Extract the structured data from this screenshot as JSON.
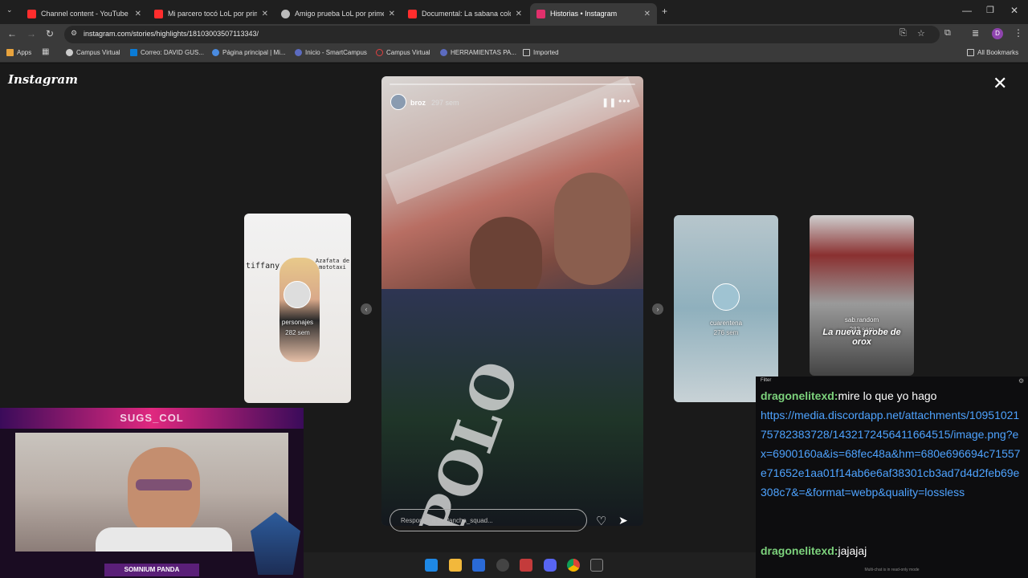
{
  "browser": {
    "tabs": [
      {
        "title": "Channel content - YouTube Stu",
        "icon": "youtube-icon",
        "color": "#ff2d2d"
      },
      {
        "title": "Mi parcero tocó LoL por prime",
        "icon": "youtube-icon",
        "color": "#ff2d2d"
      },
      {
        "title": "Amigo prueba LoL por primera",
        "icon": "globe-icon",
        "color": "#bbbbbb"
      },
      {
        "title": "Documental: La sabana colomb",
        "icon": "youtube-icon",
        "color": "#ff2d2d"
      },
      {
        "title": "Historias • Instagram",
        "icon": "instagram-icon",
        "color": "#e1306c"
      }
    ],
    "url": "instagram.com/stories/highlights/18103003507113343/",
    "bookmarks": [
      {
        "label": "Apps",
        "color": "#e8a33d"
      },
      {
        "label": "Campus Virtual",
        "color": "#cccccc"
      },
      {
        "label": "Correo: DAVID GUS...",
        "color": "#0a7bd6"
      },
      {
        "label": "Página principal | Mi...",
        "color": "#4a8be0"
      },
      {
        "label": "Inicio - SmartCampus",
        "color": "#5c6bc0"
      },
      {
        "label": "Campus Virtual",
        "color": "#e04040"
      },
      {
        "label": "HERRAMIENTAS PA...",
        "color": "#5c6bc0"
      },
      {
        "label": "Imported",
        "color": "#cccccc"
      }
    ],
    "all_bookmarks": "All Bookmarks",
    "profile_initial": "D"
  },
  "instagram": {
    "logo": "Instagram",
    "story": {
      "username": "broz",
      "time": "297 sem",
      "reply_placeholder": "Responde a avalancha_squad...",
      "shirt_text": "POLO"
    },
    "left_highlight": {
      "name": "personajes",
      "time": "282 sem",
      "overlay_left": "tiffany",
      "overlay_right": "Azafata de mototaxi"
    },
    "right_highlights": [
      {
        "name": "cuarentena",
        "time": "276 sem"
      },
      {
        "name": "sab.random",
        "time": "283 sem",
        "caption": "La nueva probe de orox"
      }
    ]
  },
  "stream": {
    "banner": "SUGS_COL",
    "footer": "SOMNIUM PANDA",
    "chat": {
      "filter": "Filter",
      "messages": [
        {
          "user": "dragonelitexd",
          "text": "mire lo que yo hago"
        },
        {
          "user": "",
          "text": "https://media.discordapp.net/attachments/1095102175782383728/1432172456411664515/image.png?ex=6900160a&is=68fec48a&hm=680e696694c71557e71652e1aa01f14ab6e6af38301cb3ad7d4d2feb69e308c7&=&format=webp&quality=lossless"
        },
        {
          "user": "dragonelitexd",
          "text": "jajajaj"
        }
      ],
      "footer_note": "Multi-chat is in read-only mode"
    }
  }
}
